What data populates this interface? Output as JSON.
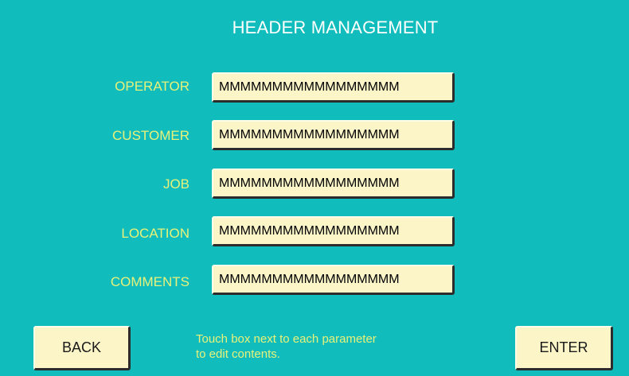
{
  "screen": {
    "title": "HEADER MANAGEMENT"
  },
  "fields": [
    {
      "label": "OPERATOR",
      "value": "MMMMMMMMMMMMMMMMM"
    },
    {
      "label": "CUSTOMER",
      "value": "MMMMMMMMMMMMMMMMM"
    },
    {
      "label": "JOB",
      "value": "MMMMMMMMMMMMMMMMM"
    },
    {
      "label": "LOCATION",
      "value": "MMMMMMMMMMMMMMMMM"
    },
    {
      "label": "COMMENTS",
      "value": "MMMMMMMMMMMMMMMMM"
    }
  ],
  "footer": {
    "back_label": "BACK",
    "enter_label": "ENTER",
    "hint_line1": "Touch box next to each parameter",
    "hint_line2": "to edit contents."
  },
  "colors": {
    "background": "#10bcbc",
    "label_text": "#e8f27a",
    "title_text": "#ffffff",
    "field_fill": "#fbf5c8"
  }
}
